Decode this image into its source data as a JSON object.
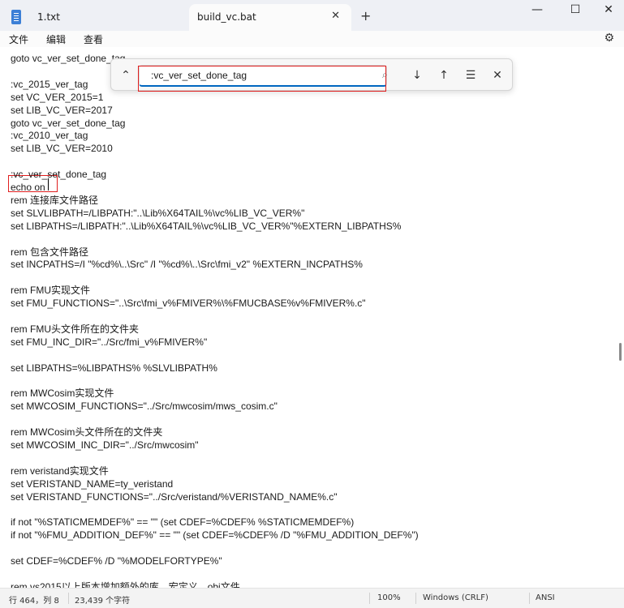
{
  "tabs": [
    {
      "label": "1.txt"
    },
    {
      "label": "build_vc.bat",
      "active": true
    }
  ],
  "menu": {
    "file": "文件",
    "edit": "编辑",
    "view": "查看"
  },
  "find": {
    "value": ":vc_ver_set_done_tag"
  },
  "editor": {
    "lines": [
      "goto vc_ver_set_done_tag",
      "",
      ":vc_2015_ver_tag",
      "set VC_VER_2015=1",
      "set LIB_VC_VER=2017",
      "goto vc_ver_set_done_tag",
      ":vc_2010_ver_tag",
      "set LIB_VC_VER=2010",
      "",
      ":vc_ver_set_done_tag",
      "echo on",
      "rem 连接库文件路径",
      "set SLVLIBPATH=/LIBPATH:\"..\\Lib%X64TAIL%\\vc%LIB_VC_VER%\"",
      "set LIBPATHS=/LIBPATH:\"..\\Lib%X64TAIL%\\vc%LIB_VC_VER%\"%EXTERN_LIBPATHS%",
      "",
      "rem 包含文件路径",
      "set INCPATHS=/I \"%cd%\\..\\Src\" /I \"%cd%\\..\\Src\\fmi_v2\" %EXTERN_INCPATHS%",
      "",
      "rem FMU实现文件",
      "set FMU_FUNCTIONS=\"..\\Src\\fmi_v%FMIVER%\\%FMUCBASE%v%FMIVER%.c\"",
      "",
      "rem FMU头文件所在的文件夹",
      "set FMU_INC_DIR=\"../Src/fmi_v%FMIVER%\"",
      "",
      "set LIBPATHS=%LIBPATHS% %SLVLIBPATH%",
      "",
      "rem MWCosim实现文件",
      "set MWCOSIM_FUNCTIONS=\"../Src/mwcosim/mws_cosim.c\"",
      "",
      "rem MWCosim头文件所在的文件夹",
      "set MWCOSIM_INC_DIR=\"../Src/mwcosim\"",
      "",
      "rem veristand实现文件",
      "set VERISTAND_NAME=ty_veristand",
      "set VERISTAND_FUNCTIONS=\"../Src/veristand/%VERISTAND_NAME%.c\"",
      "",
      "if not \"%STATICMEMDEF%\" == \"\" (set CDEF=%CDEF% %STATICMEMDEF%)",
      "if not \"%FMU_ADDITION_DEF%\" == \"\" (set CDEF=%CDEF% /D \"%FMU_ADDITION_DEF%\")",
      "",
      "set CDEF=%CDEF% /D \"%MODELFORTYPE%\"",
      "",
      "rem vs2015以上版本增加额外的库、宏定义、obj文件"
    ]
  },
  "status": {
    "position": "行 464，列 8",
    "chars": "23,439 个字符",
    "zoom": "100%",
    "line_ending": "Windows (CRLF)",
    "encoding": "ANSI"
  },
  "colors": {
    "highlight_box": "#e01f1f",
    "accent": "#0067c0"
  }
}
